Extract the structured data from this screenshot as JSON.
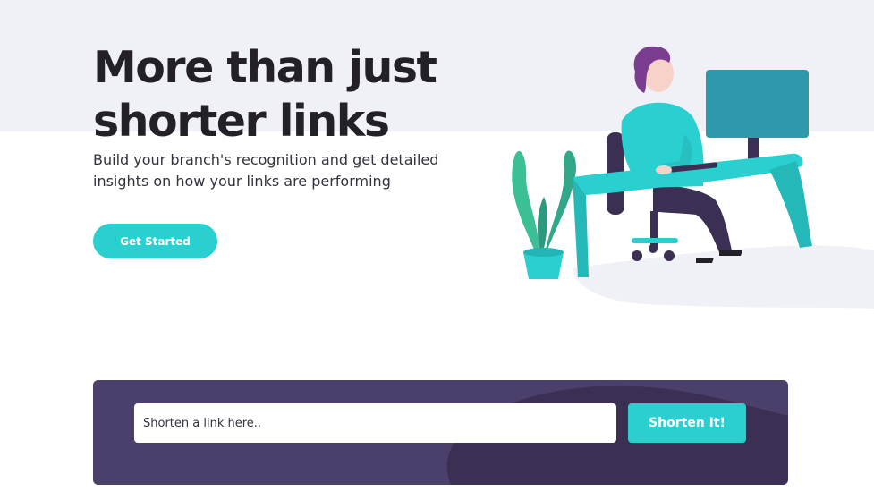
{
  "hero": {
    "title_line1": "More than just",
    "title_line2": "shorter links",
    "subtitle_line1": "Build your branch's recognition and get detailed",
    "subtitle_line2": "insights on how your links are performing",
    "cta_label": "Get Started",
    "illustration_icon": "person-working-at-desk-illustration"
  },
  "shorten": {
    "placeholder": "Shorten a link here..",
    "value": "",
    "button_label": "Shorten It!"
  },
  "colors": {
    "accent": "#2acfcf",
    "dark_violet": "#3b3054",
    "heading": "#232127",
    "band": "#f0f1f6"
  }
}
